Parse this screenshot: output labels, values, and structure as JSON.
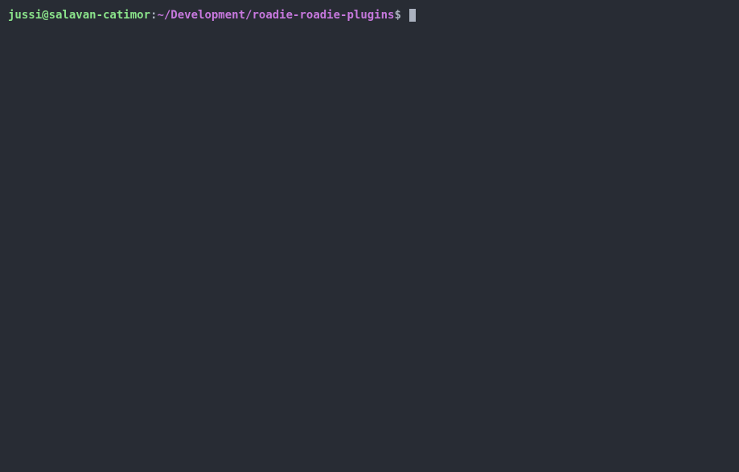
{
  "prompt": {
    "user_host": "jussi@salavan-catimor",
    "separator": ":",
    "path": "~/Development/roadie-roadie-plugins",
    "dollar": "$",
    "command": ""
  }
}
